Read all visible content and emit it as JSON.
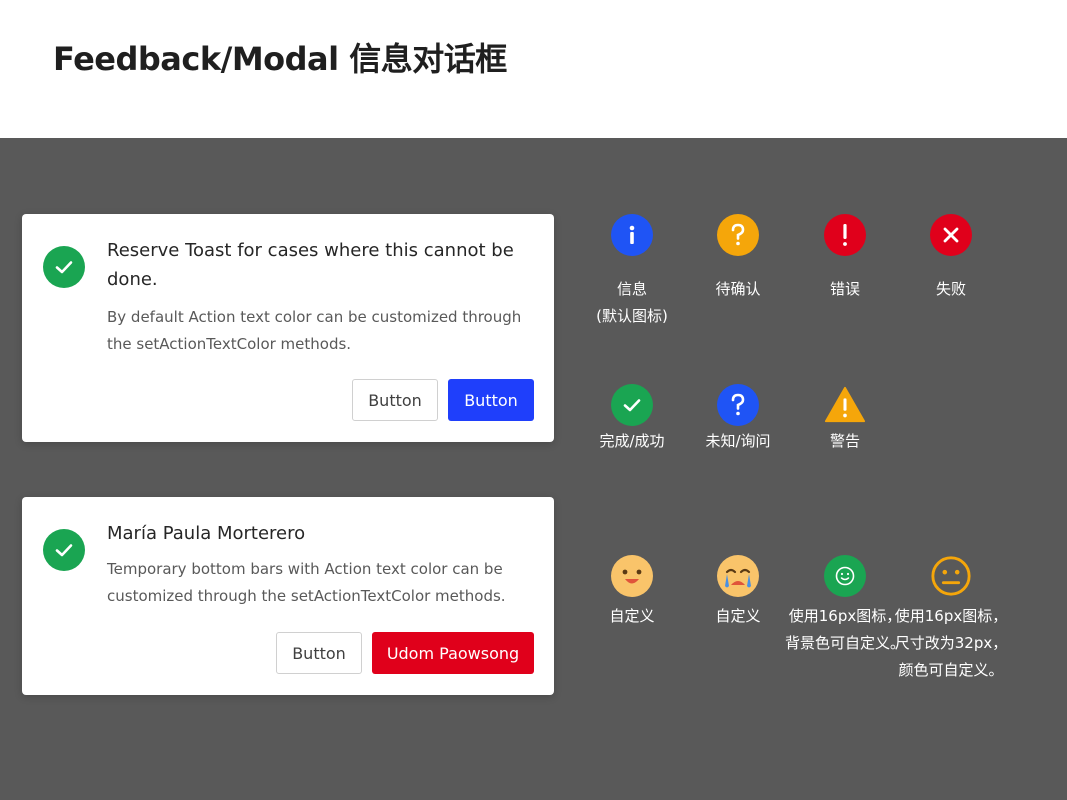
{
  "page": {
    "title": "Feedback/Modal 信息对话框"
  },
  "cards": [
    {
      "title": "Reserve Toast for cases where this cannot be done.",
      "text": "By default Action text color can be customized through the setActionTextColor methods.",
      "secondary_button": "Button",
      "primary_button": "Button",
      "icon": "check-icon"
    },
    {
      "title": "María Paula Morterero",
      "text": "Temporary bottom bars with Action text color can be customized through the setActionTextColor methods.",
      "secondary_button": "Button",
      "primary_button": "Udom Paowsong",
      "icon": "check-icon"
    }
  ],
  "icon_grid": [
    {
      "label": "信息\n(默认图标)",
      "icon": "info-icon",
      "color": "#1f54f5"
    },
    {
      "label": "待确认",
      "icon": "question-icon",
      "color": "#f5a60a"
    },
    {
      "label": "错误",
      "icon": "exclamation-icon",
      "color": "#e0001b"
    },
    {
      "label": "失败",
      "icon": "close-icon",
      "color": "#e0001b"
    },
    {
      "label": "完成/成功",
      "icon": "check-icon",
      "color": "#1aa552"
    },
    {
      "label": "未知/询问",
      "icon": "question-icon",
      "color": "#1f54f5"
    },
    {
      "label": "警告",
      "icon": "warning-icon",
      "color": "#f5a60a"
    },
    {
      "label": "自定义",
      "icon": "happy-face-icon",
      "color": "#f9c46a"
    },
    {
      "label": "自定义",
      "icon": "crying-face-icon",
      "color": "#f9c46a"
    },
    {
      "label": "使用16px图标，\n背景色可自定义。",
      "icon": "smile-icon",
      "color": "#1aa552"
    },
    {
      "label": "使用16px图标，\n尺寸改为32px，\n颜色可自定义。",
      "icon": "neutral-face-icon",
      "color": "#f5a60a"
    }
  ],
  "colors": {
    "canvas": "#595959",
    "primary": "#1f3ffb",
    "danger": "#e0001b",
    "success": "#1aa552"
  }
}
